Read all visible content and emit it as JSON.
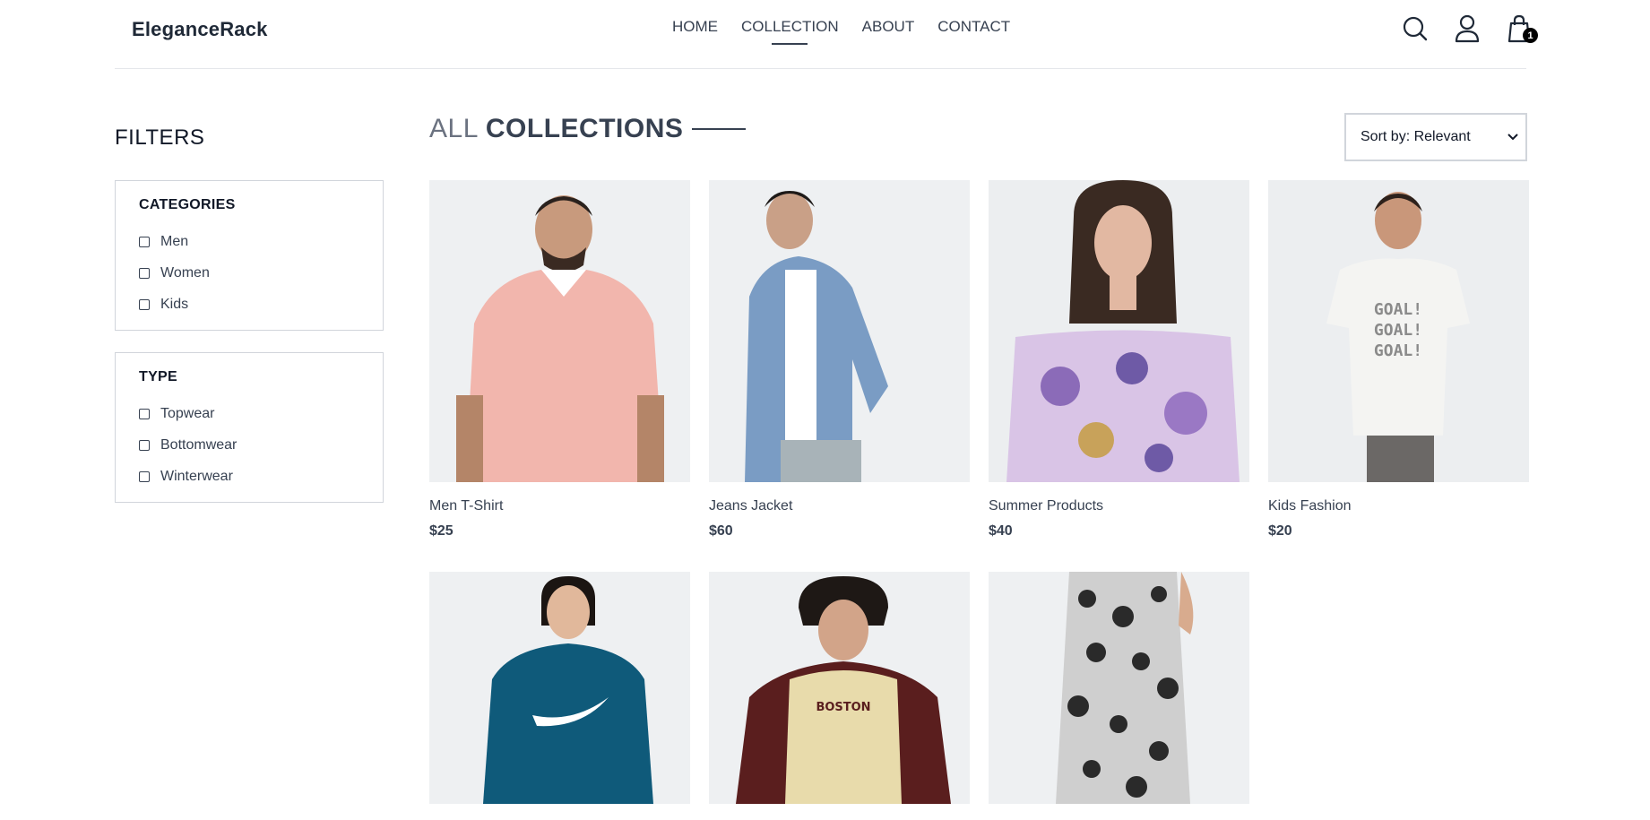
{
  "header": {
    "logo": "EleganceRack",
    "nav": [
      "HOME",
      "COLLECTION",
      "ABOUT",
      "CONTACT"
    ],
    "active_nav": "COLLECTION",
    "cart_count": "1"
  },
  "filters": {
    "title": "FILTERS",
    "categories": {
      "heading": "CATEGORIES",
      "options": [
        "Men",
        "Women",
        "Kids"
      ]
    },
    "type": {
      "heading": "TYPE",
      "options": [
        "Topwear",
        "Bottomwear",
        "Winterwear"
      ]
    }
  },
  "main": {
    "title_part1": "ALL",
    "title_part2": "COLLECTIONS",
    "sort_label": "Sort by: Relevant"
  },
  "products": [
    {
      "name": "Men T-Shirt",
      "price": "$25"
    },
    {
      "name": "Jeans Jacket",
      "price": "$60"
    },
    {
      "name": "Summer Products",
      "price": "$40"
    },
    {
      "name": "Kids Fashion",
      "price": "$20"
    },
    {
      "name": "",
      "price": ""
    },
    {
      "name": "",
      "price": ""
    },
    {
      "name": "",
      "price": ""
    }
  ],
  "colors": {
    "text": "#374151",
    "image_bg": "#f0f1f3",
    "border": "#d1d5db"
  },
  "icons": [
    "search-icon",
    "user-icon",
    "shopping-bag-icon",
    "chevron-down-icon"
  ]
}
